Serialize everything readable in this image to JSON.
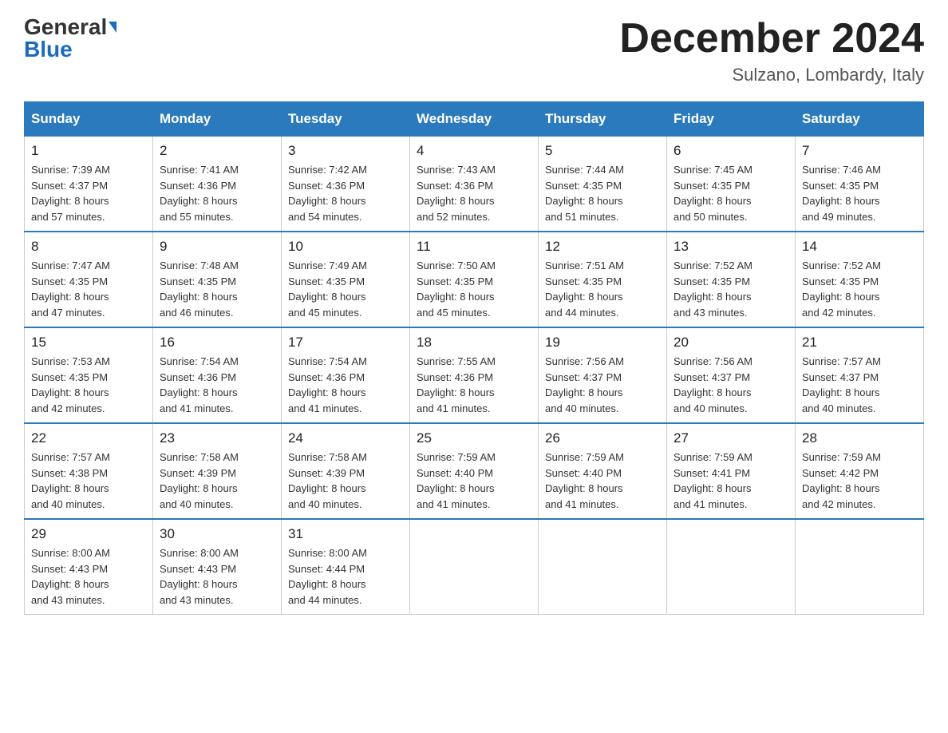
{
  "header": {
    "logo_general": "General",
    "logo_blue": "Blue",
    "month_title": "December 2024",
    "location": "Sulzano, Lombardy, Italy"
  },
  "days_of_week": [
    "Sunday",
    "Monday",
    "Tuesday",
    "Wednesday",
    "Thursday",
    "Friday",
    "Saturday"
  ],
  "weeks": [
    [
      {
        "day": "1",
        "sunrise": "7:39 AM",
        "sunset": "4:37 PM",
        "daylight": "8 hours and 57 minutes."
      },
      {
        "day": "2",
        "sunrise": "7:41 AM",
        "sunset": "4:36 PM",
        "daylight": "8 hours and 55 minutes."
      },
      {
        "day": "3",
        "sunrise": "7:42 AM",
        "sunset": "4:36 PM",
        "daylight": "8 hours and 54 minutes."
      },
      {
        "day": "4",
        "sunrise": "7:43 AM",
        "sunset": "4:36 PM",
        "daylight": "8 hours and 52 minutes."
      },
      {
        "day": "5",
        "sunrise": "7:44 AM",
        "sunset": "4:35 PM",
        "daylight": "8 hours and 51 minutes."
      },
      {
        "day": "6",
        "sunrise": "7:45 AM",
        "sunset": "4:35 PM",
        "daylight": "8 hours and 50 minutes."
      },
      {
        "day": "7",
        "sunrise": "7:46 AM",
        "sunset": "4:35 PM",
        "daylight": "8 hours and 49 minutes."
      }
    ],
    [
      {
        "day": "8",
        "sunrise": "7:47 AM",
        "sunset": "4:35 PM",
        "daylight": "8 hours and 47 minutes."
      },
      {
        "day": "9",
        "sunrise": "7:48 AM",
        "sunset": "4:35 PM",
        "daylight": "8 hours and 46 minutes."
      },
      {
        "day": "10",
        "sunrise": "7:49 AM",
        "sunset": "4:35 PM",
        "daylight": "8 hours and 45 minutes."
      },
      {
        "day": "11",
        "sunrise": "7:50 AM",
        "sunset": "4:35 PM",
        "daylight": "8 hours and 45 minutes."
      },
      {
        "day": "12",
        "sunrise": "7:51 AM",
        "sunset": "4:35 PM",
        "daylight": "8 hours and 44 minutes."
      },
      {
        "day": "13",
        "sunrise": "7:52 AM",
        "sunset": "4:35 PM",
        "daylight": "8 hours and 43 minutes."
      },
      {
        "day": "14",
        "sunrise": "7:52 AM",
        "sunset": "4:35 PM",
        "daylight": "8 hours and 42 minutes."
      }
    ],
    [
      {
        "day": "15",
        "sunrise": "7:53 AM",
        "sunset": "4:35 PM",
        "daylight": "8 hours and 42 minutes."
      },
      {
        "day": "16",
        "sunrise": "7:54 AM",
        "sunset": "4:36 PM",
        "daylight": "8 hours and 41 minutes."
      },
      {
        "day": "17",
        "sunrise": "7:54 AM",
        "sunset": "4:36 PM",
        "daylight": "8 hours and 41 minutes."
      },
      {
        "day": "18",
        "sunrise": "7:55 AM",
        "sunset": "4:36 PM",
        "daylight": "8 hours and 41 minutes."
      },
      {
        "day": "19",
        "sunrise": "7:56 AM",
        "sunset": "4:37 PM",
        "daylight": "8 hours and 40 minutes."
      },
      {
        "day": "20",
        "sunrise": "7:56 AM",
        "sunset": "4:37 PM",
        "daylight": "8 hours and 40 minutes."
      },
      {
        "day": "21",
        "sunrise": "7:57 AM",
        "sunset": "4:37 PM",
        "daylight": "8 hours and 40 minutes."
      }
    ],
    [
      {
        "day": "22",
        "sunrise": "7:57 AM",
        "sunset": "4:38 PM",
        "daylight": "8 hours and 40 minutes."
      },
      {
        "day": "23",
        "sunrise": "7:58 AM",
        "sunset": "4:39 PM",
        "daylight": "8 hours and 40 minutes."
      },
      {
        "day": "24",
        "sunrise": "7:58 AM",
        "sunset": "4:39 PM",
        "daylight": "8 hours and 40 minutes."
      },
      {
        "day": "25",
        "sunrise": "7:59 AM",
        "sunset": "4:40 PM",
        "daylight": "8 hours and 41 minutes."
      },
      {
        "day": "26",
        "sunrise": "7:59 AM",
        "sunset": "4:40 PM",
        "daylight": "8 hours and 41 minutes."
      },
      {
        "day": "27",
        "sunrise": "7:59 AM",
        "sunset": "4:41 PM",
        "daylight": "8 hours and 41 minutes."
      },
      {
        "day": "28",
        "sunrise": "7:59 AM",
        "sunset": "4:42 PM",
        "daylight": "8 hours and 42 minutes."
      }
    ],
    [
      {
        "day": "29",
        "sunrise": "8:00 AM",
        "sunset": "4:43 PM",
        "daylight": "8 hours and 43 minutes."
      },
      {
        "day": "30",
        "sunrise": "8:00 AM",
        "sunset": "4:43 PM",
        "daylight": "8 hours and 43 minutes."
      },
      {
        "day": "31",
        "sunrise": "8:00 AM",
        "sunset": "4:44 PM",
        "daylight": "8 hours and 44 minutes."
      },
      null,
      null,
      null,
      null
    ]
  ],
  "labels": {
    "sunrise": "Sunrise:",
    "sunset": "Sunset:",
    "daylight": "Daylight:"
  }
}
